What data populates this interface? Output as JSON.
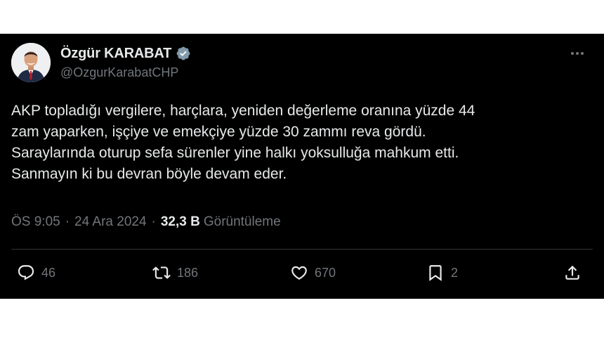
{
  "author": {
    "display_name": "Özgür KARABAT",
    "handle": "@OzgurKarabatCHP",
    "verified": true,
    "verified_color": "#829aab"
  },
  "tweet": {
    "text": "AKP topladığı vergilere, harçlara, yeniden değerleme oranına yüzde 44\nzam yaparken, işçiye ve emekçiye yüzde 30 zammı reva gördü.\nSaraylarında oturup sefa sürenler yine halkı yoksulluğa mahkum etti.\nSanmayın ki bu devran böyle devam eder.",
    "time": "ÖS 9:05",
    "separator": "·",
    "date": "24 Ara 2024",
    "views_count": "32,3 B",
    "views_label": "Görüntüleme"
  },
  "actions": {
    "replies": "46",
    "retweets": "186",
    "likes": "670",
    "bookmarks": "2"
  },
  "icons": {
    "more": "more-dots-icon",
    "reply": "reply-icon",
    "retweet": "retweet-icon",
    "like": "heart-icon",
    "bookmark": "bookmark-icon",
    "share": "share-icon"
  },
  "colors": {
    "background": "#000000",
    "text": "#e7e9ea",
    "muted": "#71767b"
  }
}
